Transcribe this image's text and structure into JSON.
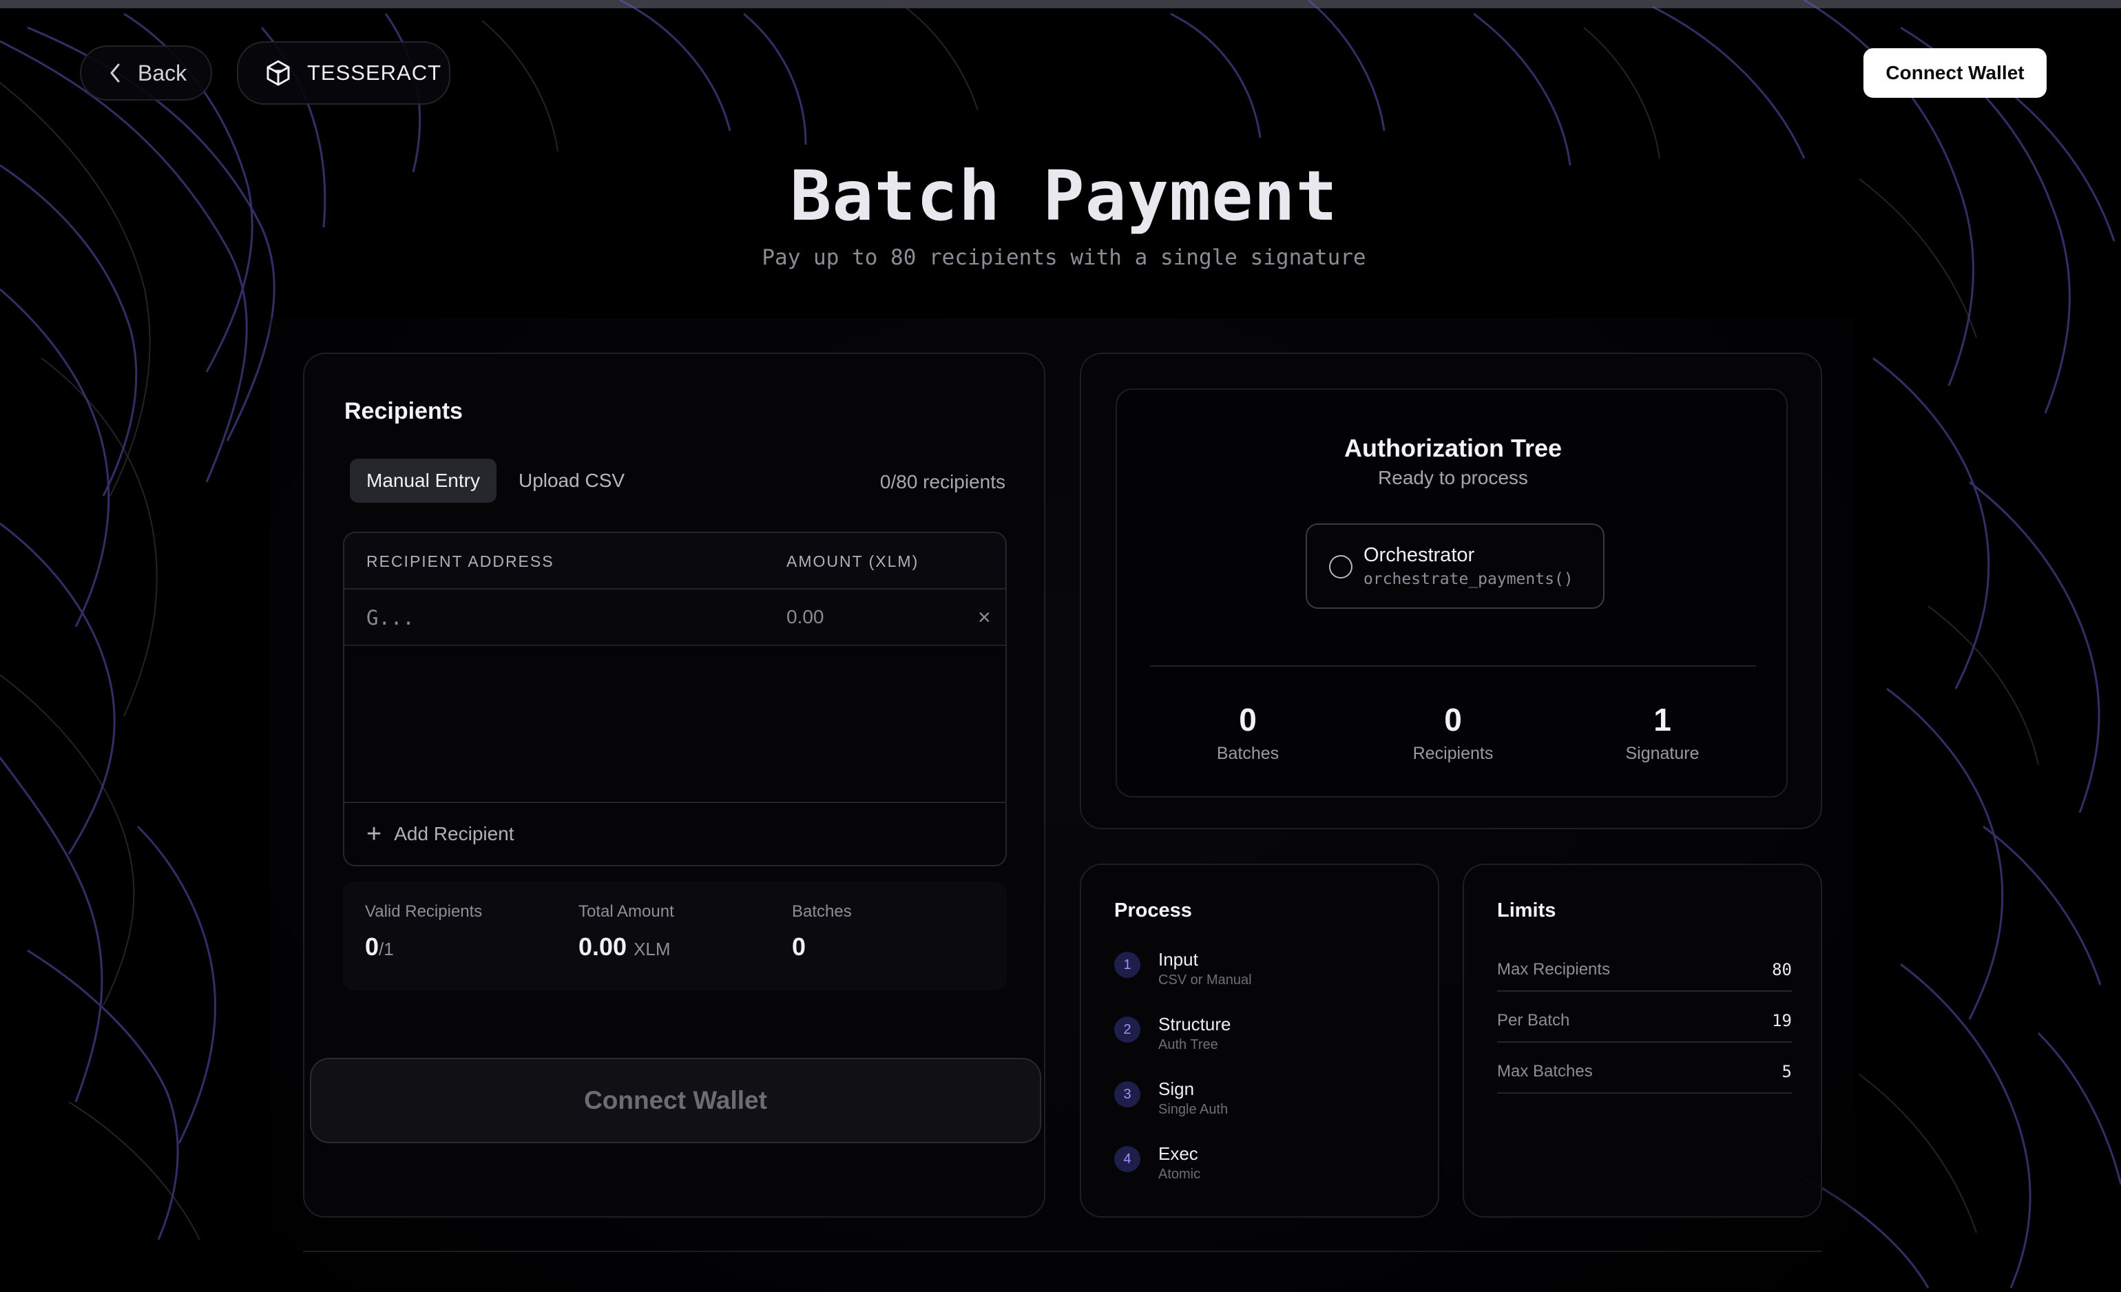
{
  "nav": {
    "back_label": "Back",
    "brand": "TESSERACT",
    "connect_label": "Connect Wallet"
  },
  "hero": {
    "title": "Batch Payment",
    "subtitle": "Pay up to 80 recipients with a single signature"
  },
  "recipients": {
    "title": "Recipients",
    "tabs": [
      {
        "label": "Manual Entry",
        "active": true
      },
      {
        "label": "Upload CSV",
        "active": false
      }
    ],
    "count_text": "0/80 recipients",
    "columns": {
      "address": "RECIPIENT ADDRESS",
      "amount": "AMOUNT (XLM)"
    },
    "rows": [
      {
        "address_placeholder": "G...",
        "amount_placeholder": "0.00"
      }
    ],
    "add_label": "Add Recipient",
    "summary": {
      "valid_label": "Valid Recipients",
      "valid_value": "0",
      "valid_total": "/1",
      "total_label": "Total Amount",
      "total_value": "0.00",
      "total_unit": "XLM",
      "batches_label": "Batches",
      "batches_value": "0"
    },
    "connect_label": "Connect Wallet"
  },
  "auth_tree": {
    "title": "Authorization Tree",
    "status": "Ready to process",
    "node_title": "Orchestrator",
    "node_fn": "orchestrate_payments()",
    "stats": [
      {
        "value": "0",
        "label": "Batches"
      },
      {
        "value": "0",
        "label": "Recipients"
      },
      {
        "value": "1",
        "label": "Signature"
      }
    ]
  },
  "process": {
    "title": "Process",
    "steps": [
      {
        "num": "1",
        "title": "Input",
        "sub": "CSV or Manual"
      },
      {
        "num": "2",
        "title": "Structure",
        "sub": "Auth Tree"
      },
      {
        "num": "3",
        "title": "Sign",
        "sub": "Single Auth"
      },
      {
        "num": "4",
        "title": "Exec",
        "sub": "Atomic"
      }
    ]
  },
  "limits": {
    "title": "Limits",
    "items": [
      {
        "label": "Max Recipients",
        "value": "80"
      },
      {
        "label": "Per Batch",
        "value": "19"
      },
      {
        "label": "Max Batches",
        "value": "5"
      }
    ]
  },
  "colors": {
    "accent": "#8a86ff",
    "background": "#000000",
    "card": "#050508"
  }
}
